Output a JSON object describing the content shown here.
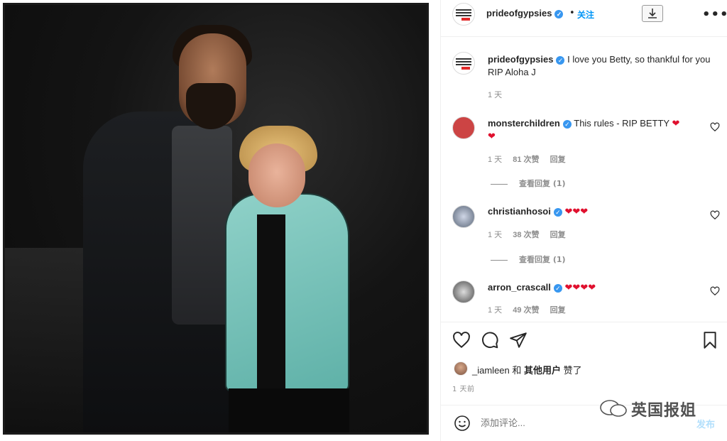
{
  "header": {
    "username": "prideofgypsies",
    "separator": "•",
    "follow_label": "关注"
  },
  "caption": {
    "username": "prideofgypsies",
    "text": "I love you Betty, so thankful for you RIP Aloha J",
    "time": "1 天"
  },
  "comments": [
    {
      "username": "monsterchildren",
      "text": "This rules - RIP BETTY",
      "hearts_inline": "❤",
      "hearts_next_line": "❤",
      "time": "1 天",
      "likes": "81 次赞",
      "reply": "回复",
      "view_replies": "查看回复 (1)"
    },
    {
      "username": "christianhosoi",
      "hearts": "❤❤❤",
      "time": "1 天",
      "likes": "38 次赞",
      "reply": "回复",
      "view_replies": "查看回复 (1)"
    },
    {
      "username": "arron_crascall",
      "hearts": "❤❤❤❤",
      "time": "1 天",
      "likes": "49 次赞",
      "reply": "回复"
    }
  ],
  "likes": {
    "first_user": "_iamleen",
    "conjunction": "和",
    "others": "其他用户",
    "suffix": "赞了"
  },
  "post_time": "1 天前",
  "composer": {
    "placeholder": "添加评论...",
    "post_label": "发布"
  },
  "watermark": "英国报姐",
  "colors": {
    "accent": "#0095f6",
    "heart": "#e0102e",
    "muted": "#8e8e8e"
  },
  "icons": [
    "download-icon",
    "more-icon",
    "heart-icon",
    "comment-icon",
    "share-icon",
    "bookmark-icon",
    "emoji-icon",
    "verified-icon"
  ]
}
